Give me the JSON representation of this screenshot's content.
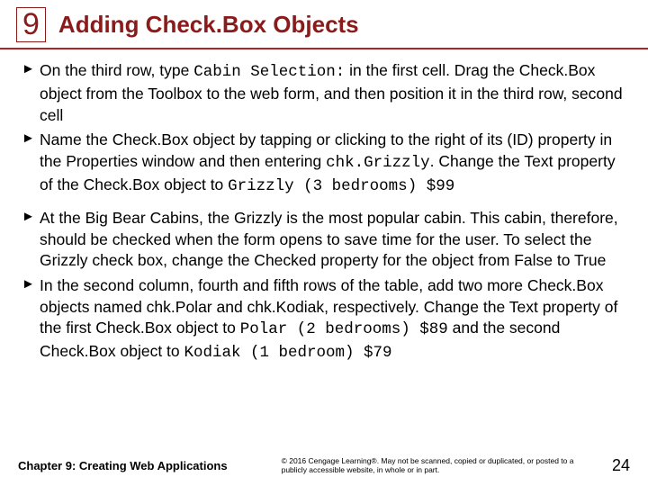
{
  "header": {
    "chapter_number": "9",
    "title": "Adding Check.Box Objects"
  },
  "bullets": [
    {
      "pre": "On the third row, type ",
      "code1": "Cabin Selection:",
      "mid": " in the first cell. Drag the Check.Box object from the Toolbox to the web form, and then position it in the third row, second cell",
      "code2": "",
      "post": ""
    },
    {
      "pre": "Name the Check.Box object by tapping or clicking to the right of its (ID) property in the Properties window and then entering ",
      "code1": "chk.Grizzly",
      "mid": ". Change the Text property of the Check.Box object to ",
      "code2": "Grizzly (3 bedrooms) $99",
      "post": ""
    },
    {
      "pre": "At the Big Bear Cabins, the Grizzly is the most popular cabin. This cabin, therefore, should be checked when the form opens to save time for the user. To select the Grizzly check box, change the Checked property for the object from False to True",
      "code1": "",
      "mid": "",
      "code2": "",
      "post": ""
    },
    {
      "pre": "In the second column, fourth and fifth rows of the table, add two more Check.Box objects named chk.Polar and chk.Kodiak, respectively. Change the Text property of the first Check.Box object to ",
      "code1": "Polar (2 bedrooms) $89",
      "mid": " and the second Check.Box object to ",
      "code2": "Kodiak (1 bedroom) $79",
      "post": ""
    }
  ],
  "footer": {
    "left": "Chapter 9: Creating Web Applications",
    "center": "© 2016 Cengage Learning®. May not be scanned, copied or duplicated, or posted to a publicly accessible website, in whole or in part.",
    "page": "24"
  }
}
